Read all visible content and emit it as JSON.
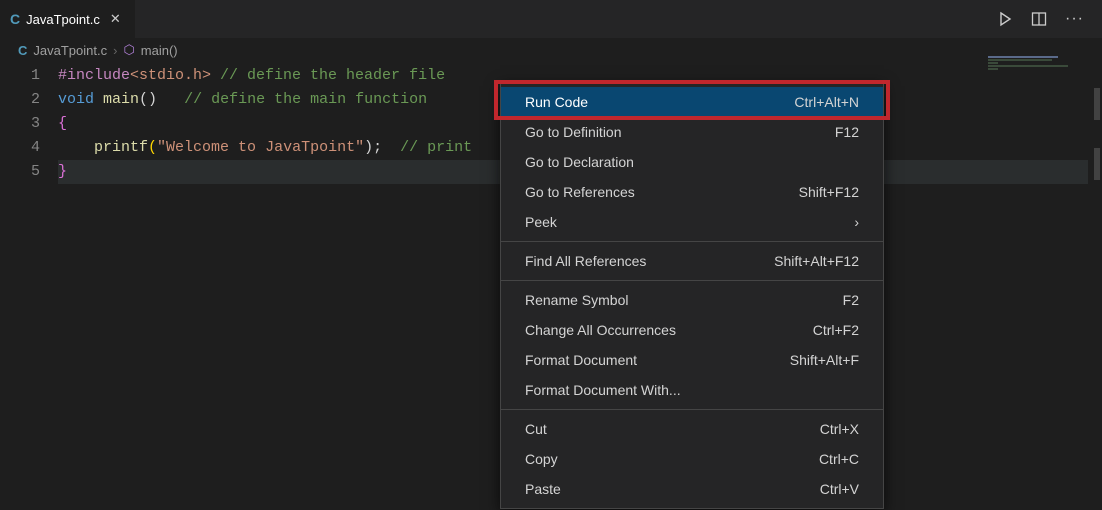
{
  "tab": {
    "filename": "JavaTpoint.c",
    "close_glyph": "✕"
  },
  "breadcrumb": {
    "file": "JavaTpoint.c",
    "symbol": "main()"
  },
  "gutter": [
    "1",
    "2",
    "3",
    "4",
    "5"
  ],
  "code": {
    "l1_a": "#include",
    "l1_b": "<stdio.h>",
    "l1_c": " // define the header file",
    "l2_a": "void",
    "l2_b": " ",
    "l2_c": "main",
    "l2_d": "()   ",
    "l2_e": "// define the main function",
    "l3_a": "{",
    "l4_a": "    ",
    "l4_b": "printf",
    "l4_c": "(",
    "l4_d": "\"Welcome to JavaTpoint\"",
    "l4_e": ");  ",
    "l4_f": "// print",
    "l5_a": "}"
  },
  "menu": {
    "run_code": "Run Code",
    "run_code_sc": "Ctrl+Alt+N",
    "go_def": "Go to Definition",
    "go_def_sc": "F12",
    "go_decl": "Go to Declaration",
    "go_decl_sc": "",
    "go_ref": "Go to References",
    "go_ref_sc": "Shift+F12",
    "peek": "Peek",
    "find_ref": "Find All References",
    "find_ref_sc": "Shift+Alt+F12",
    "rename": "Rename Symbol",
    "rename_sc": "F2",
    "change": "Change All Occurrences",
    "change_sc": "Ctrl+F2",
    "fmt": "Format Document",
    "fmt_sc": "Shift+Alt+F",
    "fmt_with": "Format Document With...",
    "cut": "Cut",
    "cut_sc": "Ctrl+X",
    "copy": "Copy",
    "copy_sc": "Ctrl+C",
    "paste": "Paste",
    "paste_sc": "Ctrl+V"
  }
}
